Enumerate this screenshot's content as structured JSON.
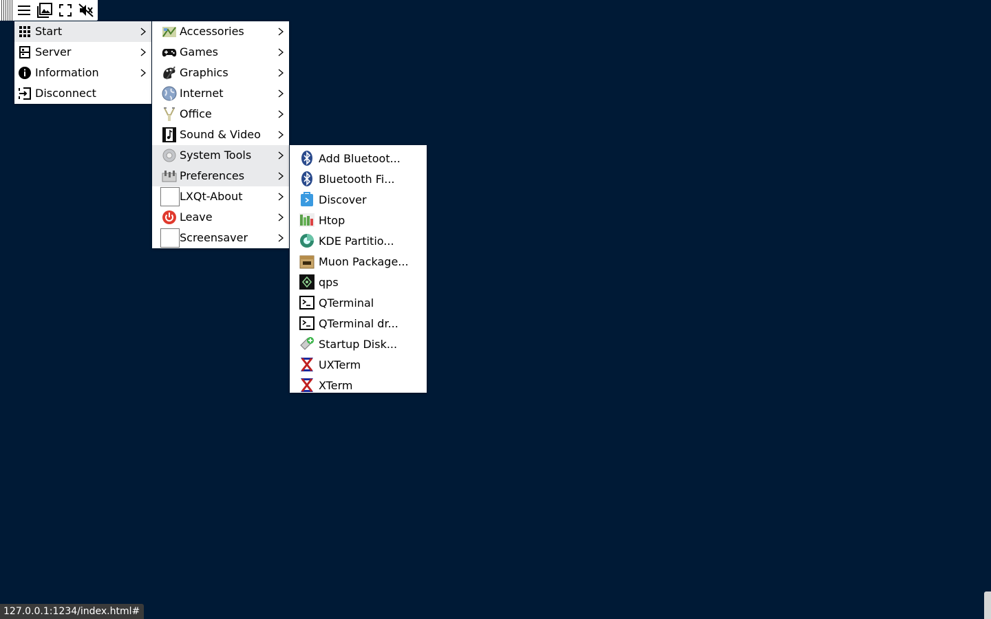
{
  "toolbar": {
    "buttons": [
      {
        "icon": "hamburger-menu-icon"
      },
      {
        "icon": "image-icon"
      },
      {
        "icon": "fullscreen-icon"
      },
      {
        "icon": "sound-muted-icon"
      }
    ]
  },
  "main_menu": {
    "items": [
      {
        "label": "Start",
        "icon": "grid-icon",
        "submenu": true,
        "highlighted": true
      },
      {
        "label": "Server",
        "icon": "server-icon",
        "submenu": true
      },
      {
        "label": "Information",
        "icon": "info-icon",
        "submenu": true
      },
      {
        "label": "Disconnect",
        "icon": "disconnect-icon",
        "submenu": false
      }
    ]
  },
  "start_menu": {
    "items": [
      {
        "label": "Accessories",
        "icon": "accessories-icon"
      },
      {
        "label": "Games",
        "icon": "gamepad-icon"
      },
      {
        "label": "Graphics",
        "icon": "graphics-icon"
      },
      {
        "label": "Internet",
        "icon": "globe-icon"
      },
      {
        "label": "Office",
        "icon": "office-icon"
      },
      {
        "label": "Sound & Video",
        "icon": "film-icon"
      },
      {
        "label": "System Tools",
        "icon": "system-tools-icon",
        "highlighted": true
      },
      {
        "label": "Preferences",
        "icon": "preferences-icon",
        "highlighted": true
      },
      {
        "label": "LXQt-About",
        "icon": "blank-icon"
      },
      {
        "label": "Leave",
        "icon": "power-icon"
      },
      {
        "label": "Screensaver",
        "icon": "blank-icon"
      }
    ]
  },
  "system_tools_menu": {
    "items": [
      {
        "label": "Add Bluetoot...",
        "icon": "bluetooth-icon"
      },
      {
        "label": "Bluetooth Fi...",
        "icon": "bluetooth-icon"
      },
      {
        "label": "Discover",
        "icon": "discover-icon"
      },
      {
        "label": "Htop",
        "icon": "htop-icon"
      },
      {
        "label": "KDE Partitio...",
        "icon": "partition-icon"
      },
      {
        "label": "Muon Package...",
        "icon": "package-icon"
      },
      {
        "label": "qps",
        "icon": "qps-icon"
      },
      {
        "label": "QTerminal",
        "icon": "terminal-icon"
      },
      {
        "label": "QTerminal dr...",
        "icon": "terminal-icon"
      },
      {
        "label": "Startup Disk...",
        "icon": "startup-disk-icon"
      },
      {
        "label": "UXTerm",
        "icon": "xterm-icon"
      },
      {
        "label": "XTerm",
        "icon": "xterm-icon"
      }
    ]
  },
  "status_bar": {
    "url": "127.0.0.1:1234/index.html#"
  },
  "colors": {
    "desktop_background": "#001a36",
    "menu_background": "#ffffff",
    "highlight": "#e9eaec"
  }
}
